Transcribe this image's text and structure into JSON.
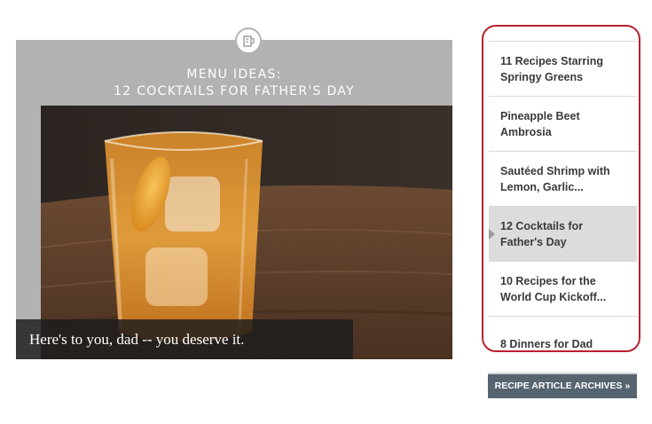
{
  "feature": {
    "title_line1": "MENU IDEAS:",
    "title_line2": "12 COCKTAILS FOR FATHER'S DAY",
    "caption": "Here's to you, dad -- you deserve it.",
    "badge_icon": "measuring-cup-icon"
  },
  "sidebar": {
    "items": [
      {
        "label": "11 Recipes Starring Springy Greens",
        "active": false
      },
      {
        "label": "Pineapple Beet Ambrosia",
        "active": false
      },
      {
        "label": "Sautéed Shrimp with Lemon, Garlic...",
        "active": false
      },
      {
        "label": "12 Cocktails for Father's Day",
        "active": true
      },
      {
        "label": "10 Recipes for the World Cup Kickoff...",
        "active": false
      },
      {
        "label": "8 Dinners for Dad",
        "active": false
      }
    ],
    "highlight_color": "#b8202e"
  },
  "archive_button": {
    "label": "RECIPE ARTICLE ARCHIVES »"
  }
}
